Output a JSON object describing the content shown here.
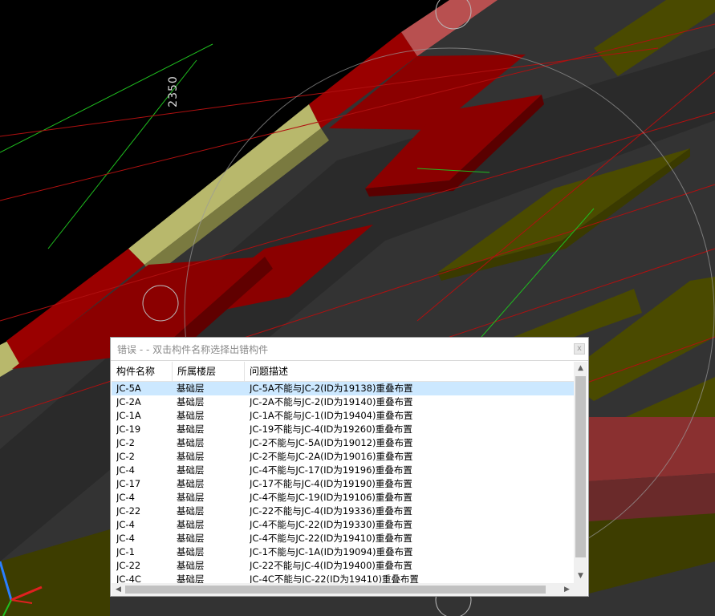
{
  "scene": {
    "dimension_label": "2350"
  },
  "dialog": {
    "title": "错误 - - 双击构件名称选择出错构件",
    "close_glyph": "x",
    "columns": [
      "构件名称",
      "所属楼层",
      "问题描述"
    ],
    "rows": [
      {
        "name": "JC-5A",
        "floor": "基础层",
        "desc": "JC-5A不能与JC-2(ID为19138)重叠布置",
        "selected": true
      },
      {
        "name": "JC-2A",
        "floor": "基础层",
        "desc": "JC-2A不能与JC-2(ID为19140)重叠布置"
      },
      {
        "name": "JC-1A",
        "floor": "基础层",
        "desc": "JC-1A不能与JC-1(ID为19404)重叠布置"
      },
      {
        "name": "JC-19",
        "floor": "基础层",
        "desc": "JC-19不能与JC-4(ID为19260)重叠布置"
      },
      {
        "name": "JC-2",
        "floor": "基础层",
        "desc": "JC-2不能与JC-5A(ID为19012)重叠布置"
      },
      {
        "name": "JC-2",
        "floor": "基础层",
        "desc": "JC-2不能与JC-2A(ID为19016)重叠布置"
      },
      {
        "name": "JC-4",
        "floor": "基础层",
        "desc": "JC-4不能与JC-17(ID为19196)重叠布置"
      },
      {
        "name": "JC-17",
        "floor": "基础层",
        "desc": "JC-17不能与JC-4(ID为19190)重叠布置"
      },
      {
        "name": "JC-4",
        "floor": "基础层",
        "desc": "JC-4不能与JC-19(ID为19106)重叠布置"
      },
      {
        "name": "JC-22",
        "floor": "基础层",
        "desc": "JC-22不能与JC-4(ID为19336)重叠布置"
      },
      {
        "name": "JC-4",
        "floor": "基础层",
        "desc": "JC-4不能与JC-22(ID为19330)重叠布置"
      },
      {
        "name": "JC-4",
        "floor": "基础层",
        "desc": "JC-4不能与JC-22(ID为19410)重叠布置"
      },
      {
        "name": "JC-1",
        "floor": "基础层",
        "desc": "JC-1不能与JC-1A(ID为19094)重叠布置"
      },
      {
        "name": "JC-22",
        "floor": "基础层",
        "desc": "JC-22不能与JC-4(ID为19400)重叠布置"
      },
      {
        "name": "JC-4C",
        "floor": "基础层",
        "desc": "JC-4C不能与JC-22(ID为19410)重叠布置"
      }
    ],
    "scroll_glyphs": {
      "up": "▲",
      "down": "▼",
      "left": "◀",
      "right": "▶"
    }
  },
  "colors": {
    "background": "#000000",
    "slab_red": "#8b0000",
    "slab_olive": "#4a4a00",
    "beam_tan": "#b4b46a",
    "selection": "#cce8ff"
  }
}
